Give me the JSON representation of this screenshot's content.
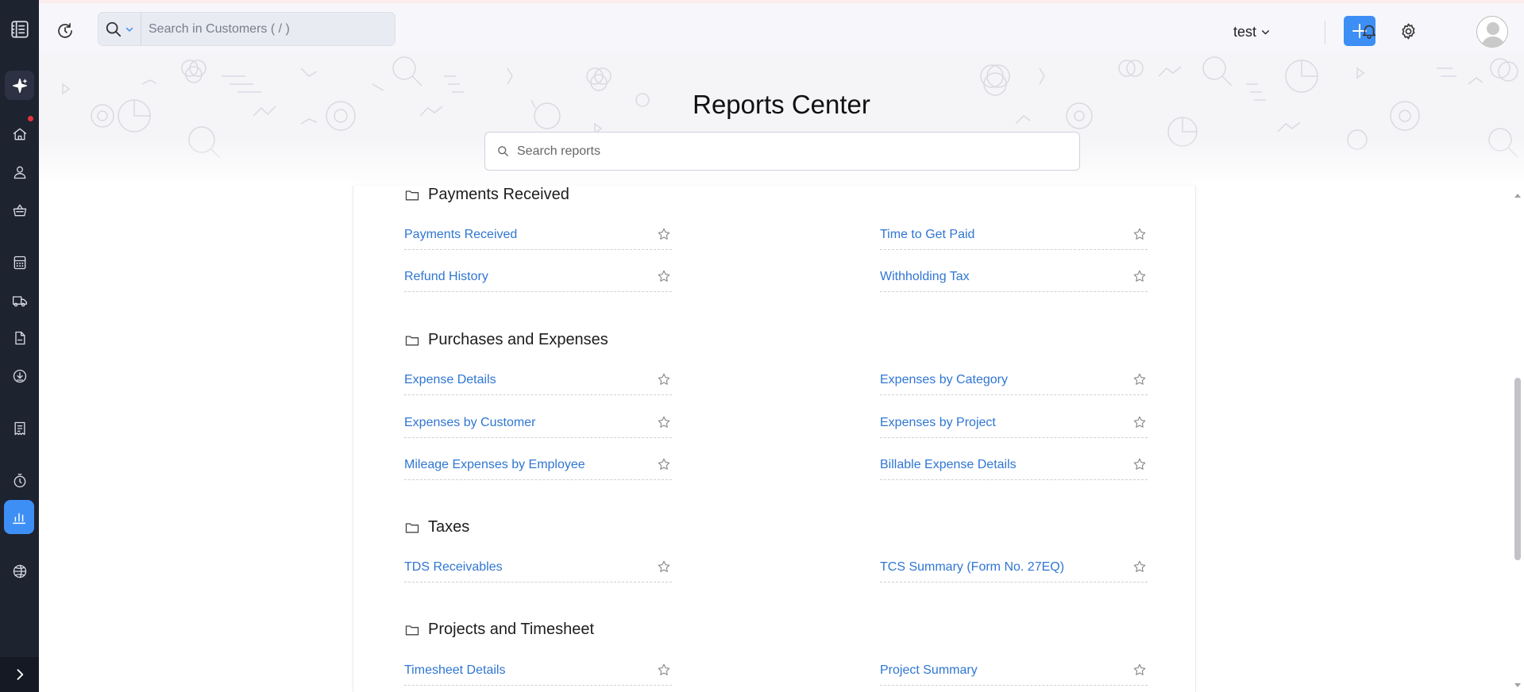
{
  "sidebar": {
    "items": [
      {
        "icon": "workspace-icon"
      },
      {
        "icon": "sparkle-ai-icon"
      },
      {
        "icon": "home-icon",
        "has_notification": true
      },
      {
        "icon": "person-icon"
      },
      {
        "icon": "shopping-basket-icon"
      },
      {
        "icon": "calculator-icon"
      },
      {
        "icon": "truck-icon"
      },
      {
        "icon": "document-icon"
      },
      {
        "icon": "download-circle-icon"
      },
      {
        "icon": "receipt-icon"
      },
      {
        "icon": "stopwatch-icon"
      },
      {
        "icon": "bar-chart-icon",
        "active": true
      },
      {
        "icon": "globe-icon"
      }
    ],
    "expand_icon": "chevron-right-icon"
  },
  "topbar": {
    "search_placeholder": "Search in Customers ( / )",
    "org_name": "test",
    "colors": {
      "accent": "#3d8ff5",
      "sidebar": "#1e2330",
      "link": "#2f76d2"
    }
  },
  "page": {
    "title": "Reports Center",
    "search_placeholder": "Search reports"
  },
  "sections": [
    {
      "name": "Payments Received",
      "reports": [
        [
          "Payments Received",
          "Time to Get Paid"
        ],
        [
          "Refund History",
          "Withholding Tax"
        ]
      ]
    },
    {
      "name": "Purchases and Expenses",
      "reports": [
        [
          "Expense Details",
          "Expenses by Category"
        ],
        [
          "Expenses by Customer",
          "Expenses by Project"
        ],
        [
          "Mileage Expenses by Employee",
          "Billable Expense Details"
        ]
      ]
    },
    {
      "name": "Taxes",
      "reports": [
        [
          "TDS Receivables",
          "TCS Summary (Form No. 27EQ)"
        ]
      ]
    },
    {
      "name": "Projects and Timesheet",
      "reports": [
        [
          "Timesheet Details",
          "Project Summary"
        ]
      ]
    }
  ]
}
